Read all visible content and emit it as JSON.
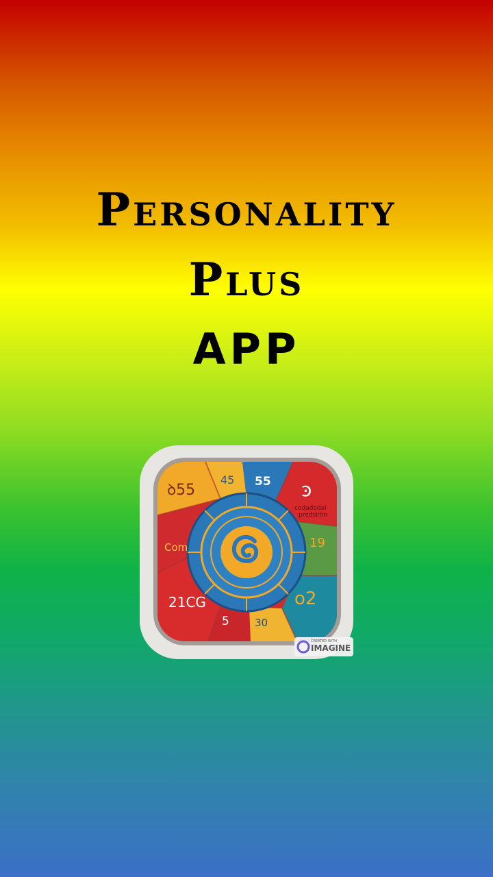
{
  "title": {
    "line1": "Personality",
    "line2": "Plus",
    "line3": "APP"
  },
  "app_icon": {
    "icon_name": "app-logo-icon",
    "labels": {
      "top_left": "ꝺ55",
      "top_mid": "45",
      "top_right": "55",
      "corner_right": "ꜿ",
      "right_small": "codadedal\npredslitin",
      "mid_left": "Com",
      "mid_right": "19",
      "bottom_left": "21CG",
      "bottom_mid_left": "5",
      "bottom_mid_right": "30",
      "bottom_right": "o2"
    },
    "watermark_small": "CREATED WITH",
    "watermark": "IMAGINE"
  },
  "colors": {
    "red": "#d52a2c",
    "yellow": "#f3a928",
    "blue": "#2b78b8",
    "green": "#5a9a45",
    "teal": "#1e8aa0",
    "frame": "#e8e6e3"
  }
}
